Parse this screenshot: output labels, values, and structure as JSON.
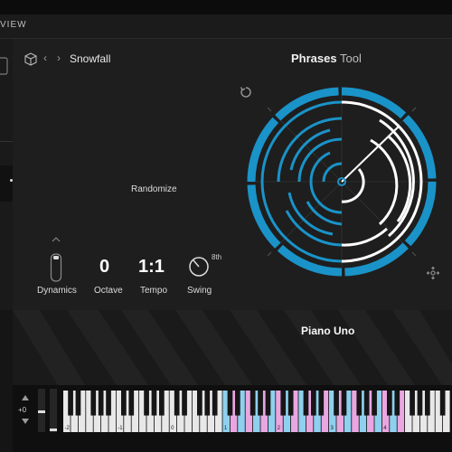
{
  "menu": {
    "view_label": "VIEW"
  },
  "header": {
    "preset_name": "Snowfall",
    "title_bold": "Phrases",
    "title_thin": "Tool"
  },
  "randomize": {
    "label": "Randomize"
  },
  "controls": {
    "dynamics": {
      "label": "Dynamics"
    },
    "octave": {
      "label": "Octave",
      "value": "0"
    },
    "tempo": {
      "label": "Tempo",
      "value": "1:1"
    },
    "swing": {
      "label": "Swing",
      "unit": "8th"
    }
  },
  "instrument": {
    "name": "Piano Uno"
  },
  "keyboard": {
    "side_value": "+0",
    "octave_labels": [
      "-2",
      "-1",
      "0",
      "1",
      "2",
      "3",
      "4"
    ]
  },
  "colors": {
    "accent_blue": "#1a93c8",
    "randomize_red": "#e23a4c",
    "randomize_purple": "#a54de0",
    "key_blue": "#8ed0ee",
    "key_pink": "#e9a6e0"
  },
  "icons": {
    "preset": "cube-icon",
    "reset": "rotate-icon",
    "move": "move-icon",
    "randomize": "waveform-icon",
    "swing": "knob-icon"
  }
}
